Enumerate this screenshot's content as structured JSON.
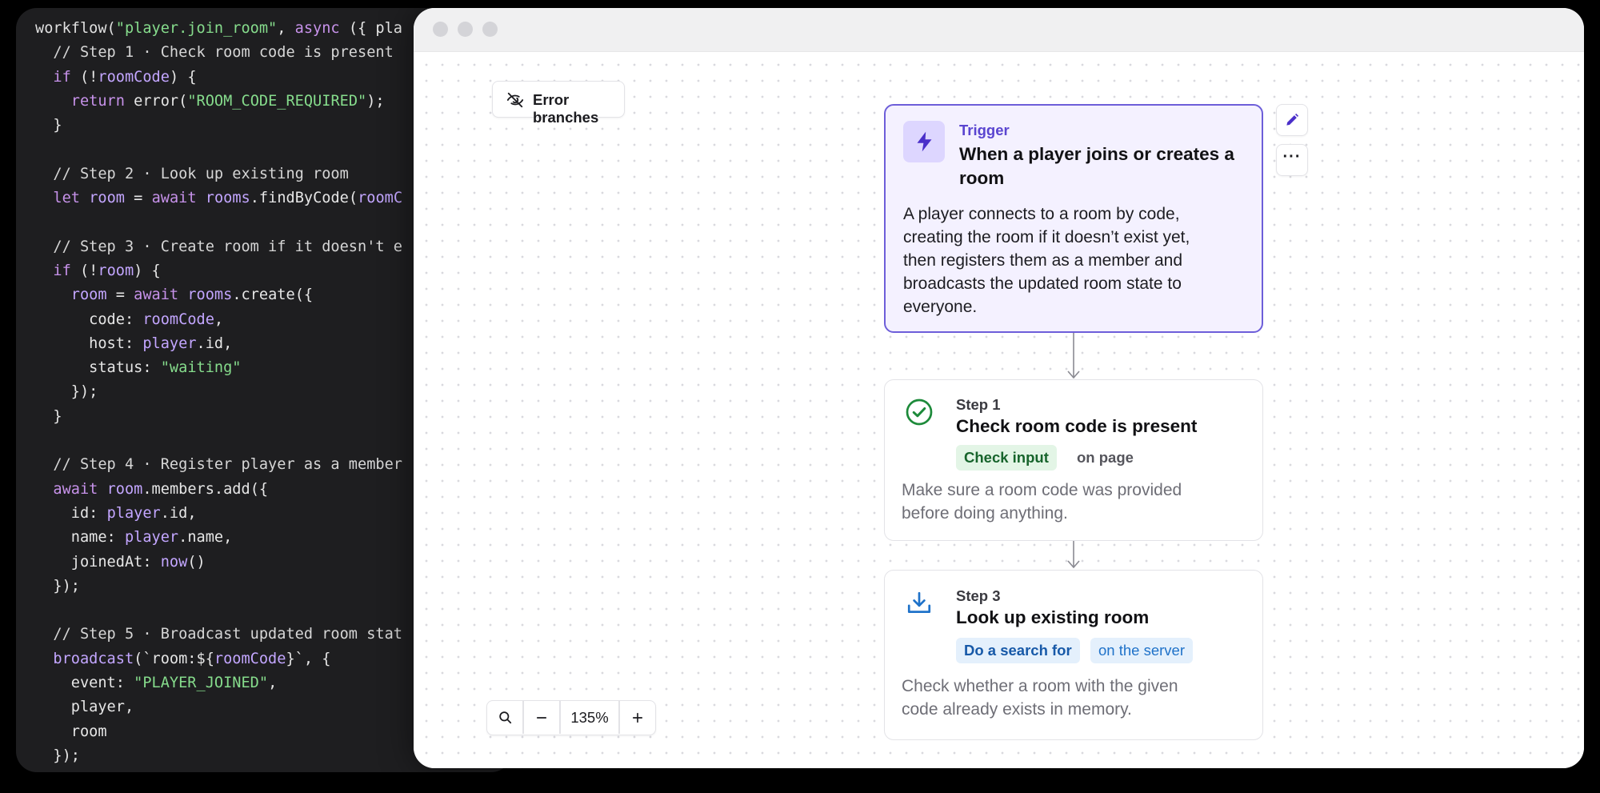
{
  "code": {
    "lines": [
      [
        {
          "t": "workflow(",
          "c": "fn"
        },
        {
          "t": "\"player.join_room\"",
          "c": "str"
        },
        {
          "t": ", ",
          "c": "p"
        },
        {
          "t": "async",
          "c": "kw"
        },
        {
          "t": " ({ pla",
          "c": "p"
        }
      ],
      [
        {
          "t": "  // Step 1 · Check room code is present",
          "c": "cm"
        }
      ],
      [
        {
          "t": "  ",
          "c": "p"
        },
        {
          "t": "if",
          "c": "kw"
        },
        {
          "t": " (!",
          "c": "p"
        },
        {
          "t": "roomCode",
          "c": "var"
        },
        {
          "t": ") {",
          "c": "p"
        }
      ],
      [
        {
          "t": "    ",
          "c": "p"
        },
        {
          "t": "return",
          "c": "kw"
        },
        {
          "t": " error(",
          "c": "p"
        },
        {
          "t": "\"ROOM_CODE_REQUIRED\"",
          "c": "str"
        },
        {
          "t": ");",
          "c": "p"
        }
      ],
      [
        {
          "t": "  }",
          "c": "p"
        }
      ],
      [
        {
          "t": "",
          "c": "p"
        }
      ],
      [
        {
          "t": "  // Step 2 · Look up existing room",
          "c": "cm"
        }
      ],
      [
        {
          "t": "  ",
          "c": "p"
        },
        {
          "t": "let",
          "c": "kw"
        },
        {
          "t": " ",
          "c": "p"
        },
        {
          "t": "room",
          "c": "var"
        },
        {
          "t": " = ",
          "c": "p"
        },
        {
          "t": "await",
          "c": "kw"
        },
        {
          "t": " ",
          "c": "p"
        },
        {
          "t": "rooms",
          "c": "var"
        },
        {
          "t": ".findByCode(",
          "c": "p"
        },
        {
          "t": "roomC",
          "c": "var"
        }
      ],
      [
        {
          "t": "",
          "c": "p"
        }
      ],
      [
        {
          "t": "  // Step 3 · Create room if it doesn't e",
          "c": "cm"
        }
      ],
      [
        {
          "t": "  ",
          "c": "p"
        },
        {
          "t": "if",
          "c": "kw"
        },
        {
          "t": " (!",
          "c": "p"
        },
        {
          "t": "room",
          "c": "var"
        },
        {
          "t": ") {",
          "c": "p"
        }
      ],
      [
        {
          "t": "    ",
          "c": "p"
        },
        {
          "t": "room",
          "c": "var"
        },
        {
          "t": " = ",
          "c": "p"
        },
        {
          "t": "await",
          "c": "kw"
        },
        {
          "t": " ",
          "c": "p"
        },
        {
          "t": "rooms",
          "c": "var"
        },
        {
          "t": ".create({",
          "c": "p"
        }
      ],
      [
        {
          "t": "      code: ",
          "c": "p"
        },
        {
          "t": "roomCode",
          "c": "var"
        },
        {
          "t": ",",
          "c": "p"
        }
      ],
      [
        {
          "t": "      host: ",
          "c": "p"
        },
        {
          "t": "player",
          "c": "var"
        },
        {
          "t": ".id,",
          "c": "p"
        }
      ],
      [
        {
          "t": "      status: ",
          "c": "p"
        },
        {
          "t": "\"waiting\"",
          "c": "str"
        }
      ],
      [
        {
          "t": "    });",
          "c": "p"
        }
      ],
      [
        {
          "t": "  }",
          "c": "p"
        }
      ],
      [
        {
          "t": "",
          "c": "p"
        }
      ],
      [
        {
          "t": "  // Step 4 · Register player as a member",
          "c": "cm"
        }
      ],
      [
        {
          "t": "  ",
          "c": "p"
        },
        {
          "t": "await",
          "c": "kw"
        },
        {
          "t": " ",
          "c": "p"
        },
        {
          "t": "room",
          "c": "var"
        },
        {
          "t": ".members.add({",
          "c": "p"
        }
      ],
      [
        {
          "t": "    id: ",
          "c": "p"
        },
        {
          "t": "player",
          "c": "var"
        },
        {
          "t": ".id,",
          "c": "p"
        }
      ],
      [
        {
          "t": "    name: ",
          "c": "p"
        },
        {
          "t": "player",
          "c": "var"
        },
        {
          "t": ".name,",
          "c": "p"
        }
      ],
      [
        {
          "t": "    joinedAt: ",
          "c": "p"
        },
        {
          "t": "now",
          "c": "var"
        },
        {
          "t": "()",
          "c": "p"
        }
      ],
      [
        {
          "t": "  });",
          "c": "p"
        }
      ],
      [
        {
          "t": "",
          "c": "p"
        }
      ],
      [
        {
          "t": "  // Step 5 · Broadcast updated room stat",
          "c": "cm"
        }
      ],
      [
        {
          "t": "  ",
          "c": "p"
        },
        {
          "t": "broadcast",
          "c": "var"
        },
        {
          "t": "(`room:${",
          "c": "p"
        },
        {
          "t": "roomCode",
          "c": "var"
        },
        {
          "t": "}`, {",
          "c": "p"
        }
      ],
      [
        {
          "t": "    event: ",
          "c": "p"
        },
        {
          "t": "\"PLAYER_JOINED\"",
          "c": "str"
        },
        {
          "t": ",",
          "c": "p"
        }
      ],
      [
        {
          "t": "    player,",
          "c": "p"
        }
      ],
      [
        {
          "t": "    room",
          "c": "p"
        }
      ],
      [
        {
          "t": "  });",
          "c": "p"
        }
      ]
    ]
  },
  "toolbar": {
    "error_branches_label": "Error branches",
    "error_branches_icon": "eye-off-icon"
  },
  "zoom": {
    "level": "135%",
    "search_icon": "search-icon",
    "minus_icon": "minus-icon",
    "plus_icon": "plus-icon"
  },
  "trigger": {
    "kicker": "Trigger",
    "title_line1": "When a player joins or creates a",
    "title_line2": "room",
    "desc_lines": [
      "A player connects to a room by code,",
      "creating the room if it doesn’t exist yet,",
      "then registers them as a member and",
      "broadcasts the updated room state to",
      "everyone."
    ],
    "icon": "lightning-bolt-icon",
    "edit_icon": "pencil-icon",
    "more_label": "···"
  },
  "step1": {
    "kicker": "Step 1",
    "title": "Check room code is present",
    "chip_primary": "Check input",
    "chip_secondary": "on page",
    "desc_lines": [
      "Make sure a room code was provided",
      "before doing anything."
    ],
    "icon": "check-circle-icon"
  },
  "step3": {
    "kicker": "Step 3",
    "title": "Look up existing room",
    "chip_primary": "Do a search for",
    "chip_secondary": "on the server",
    "desc_lines": [
      "Check whether a room with the given",
      "code already exists in memory."
    ],
    "icon": "download-tray-icon"
  },
  "colors": {
    "trigger_accent": "#6d5ed9",
    "trigger_bg": "#f4f1ff",
    "success_green": "#1d8a3a",
    "info_blue": "#1f72c9"
  }
}
